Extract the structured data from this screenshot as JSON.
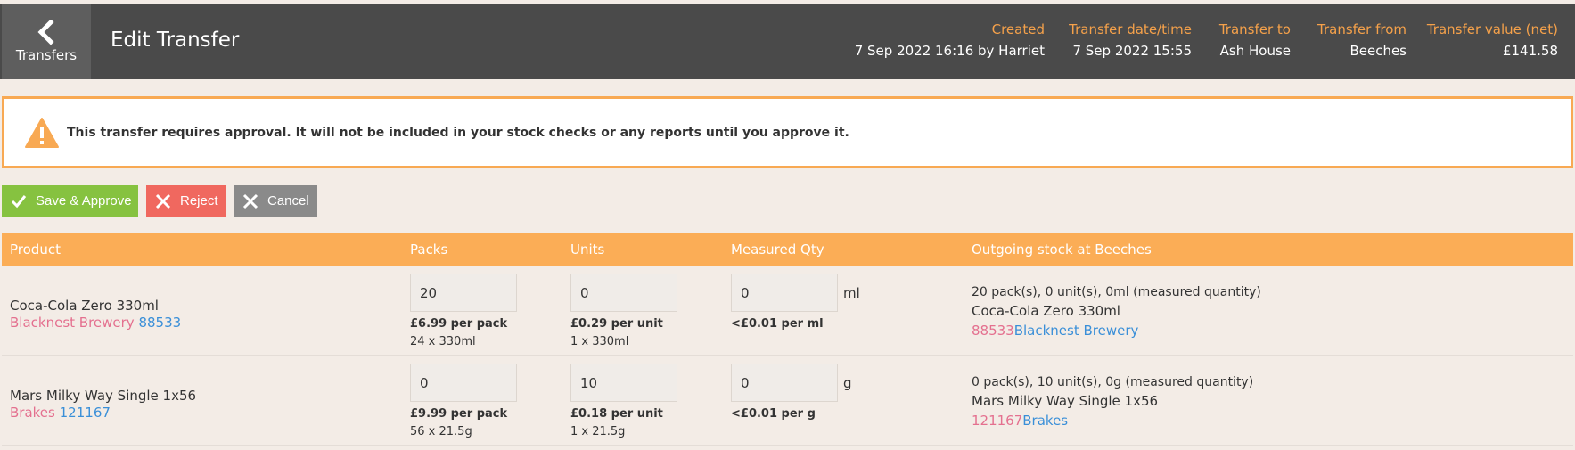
{
  "header": {
    "back_label": "Transfers",
    "title": "Edit Transfer",
    "meta": [
      {
        "label": "Created",
        "value": "7 Sep 2022 16:16 by Harriet"
      },
      {
        "label": "Transfer date/time",
        "value": "7 Sep 2022 15:55"
      },
      {
        "label": "Transfer to",
        "value": "Ash House"
      },
      {
        "label": "Transfer from",
        "value": "Beeches"
      },
      {
        "label": "Transfer value (net)",
        "value": "£141.58"
      }
    ]
  },
  "alert": {
    "text": "This transfer requires approval. It will not be included in your stock checks or any reports until you approve it."
  },
  "actions": {
    "approve_label": "Save & Approve",
    "reject_label": "Reject",
    "cancel_label": "Cancel"
  },
  "table": {
    "columns": [
      "Product",
      "Packs",
      "Units",
      "Measured Qty",
      "Outgoing stock at Beeches"
    ],
    "rows": [
      {
        "product": "Coca-Cola Zero 330ml",
        "supplier": "Blacknest Brewery",
        "code": "88533",
        "packs": "20",
        "pack_price": "£6.99 per pack",
        "pack_size": "24 x 330ml",
        "units": "0",
        "unit_price": "£0.29 per unit",
        "unit_size": "1 x 330ml",
        "measured": "0",
        "measured_unit": "ml",
        "measured_price": "<£0.01 per ml",
        "outgoing_summary": "20 pack(s), 0 unit(s), 0ml (measured quantity)",
        "outgoing_name": "Coca-Cola Zero 330ml",
        "outgoing_code": "88533",
        "outgoing_supplier": "Blacknest Brewery"
      },
      {
        "product": "Mars Milky Way Single 1x56",
        "supplier": "Brakes",
        "code": "121167",
        "packs": "0",
        "pack_price": "£9.99 per pack",
        "pack_size": "56 x 21.5g",
        "units": "10",
        "unit_price": "£0.18 per unit",
        "unit_size": "1 x 21.5g",
        "measured": "0",
        "measured_unit": "g",
        "measured_price": "<£0.01 per g",
        "outgoing_summary": "0 pack(s), 10 unit(s), 0g (measured quantity)",
        "outgoing_name": "Mars Milky Way Single 1x56",
        "outgoing_code": "121167",
        "outgoing_supplier": "Brakes"
      }
    ]
  },
  "colors": {
    "header_bg": "#4a4a4a",
    "accent_orange": "#f8a953",
    "approve_green": "#86c240",
    "reject_red": "#f0685f",
    "cancel_grey": "#8a8a8a",
    "supplier_pink": "#e4708f",
    "code_blue": "#3a8fd8"
  },
  "icons": {
    "back": "chevron-left-icon",
    "warning": "warning-triangle-icon",
    "approve": "check-icon",
    "reject": "close-icon",
    "cancel": "close-icon"
  }
}
